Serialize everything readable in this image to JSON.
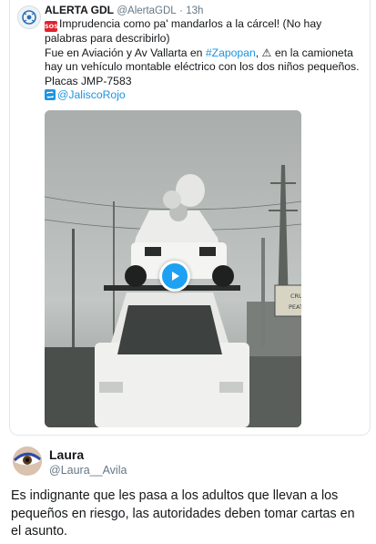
{
  "quoted_tweet": {
    "author_name": "ALERTA GDL",
    "author_handle": "@AlertaGDL",
    "separator": "·",
    "time": "13h",
    "sos_badge": "SOS",
    "line1": "Imprudencia como pa' mandarlos a la cárcel! (No hay palabras para describirlo)",
    "line2_pre": "Fue en Aviación y Av Vallarta en ",
    "hashtag": "#Zapopan",
    "line2_post": ", ⚠ en la camioneta hay un vehículo montable eléctrico con los dos niños pequeños.",
    "line3": "Placas JMP-7583",
    "retweet_mention": "@JaliscoRojo",
    "video_sign_text_1": "CRUCE DE",
    "video_sign_text_2": "PEATONES"
  },
  "reply": {
    "author_name": "Laura",
    "author_handle": "@Laura__Avila",
    "text": "Es indignante que les pasa a los adultos que llevan a los pequeños en riesgo, las autoridades deben tomar cartas en el asunto."
  },
  "colors": {
    "link": "#1b95e0",
    "play_button": "#1da1f2",
    "sos_red": "#e0232e",
    "muted_text": "#657786"
  }
}
